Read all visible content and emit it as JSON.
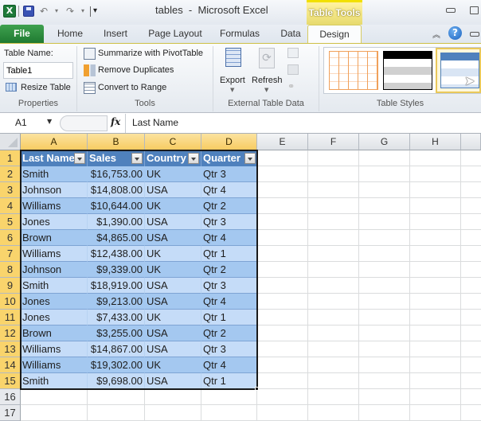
{
  "window": {
    "title": "tables  -  Microsoft Excel",
    "contextual_tab": "Table Tools"
  },
  "tabs": [
    {
      "label": "File"
    },
    {
      "label": "Home"
    },
    {
      "label": "Insert"
    },
    {
      "label": "Page Layout"
    },
    {
      "label": "Formulas"
    },
    {
      "label": "Data"
    },
    {
      "label": "Design",
      "active": true
    }
  ],
  "ribbon": {
    "properties": {
      "table_name_label": "Table Name:",
      "table_name_value": "Table1",
      "resize_label": "Resize Table",
      "group_label": "Properties"
    },
    "tools": {
      "summarize_label": "Summarize with PivotTable",
      "remove_dup_label": "Remove Duplicates",
      "convert_label": "Convert to Range",
      "group_label": "Tools"
    },
    "external": {
      "export_label": "Export",
      "refresh_label": "Refresh",
      "group_label": "External Table Data"
    },
    "styles": {
      "group_label": "Table Styles"
    }
  },
  "formula_bar": {
    "name_box": "A1",
    "fx": "fx",
    "value": "Last Name"
  },
  "sheet": {
    "columns": [
      "A",
      "B",
      "C",
      "D",
      "E",
      "F",
      "G",
      "H"
    ],
    "row_numbers": [
      "1",
      "2",
      "3",
      "4",
      "5",
      "6",
      "7",
      "8",
      "9",
      "10",
      "11",
      "12",
      "13",
      "14",
      "15",
      "16",
      "17"
    ],
    "table_headers": [
      "Last Name",
      "Sales",
      "Country",
      "Quarter"
    ],
    "rows": [
      [
        "Smith",
        "$16,753.00",
        "UK",
        "Qtr 3"
      ],
      [
        "Johnson",
        "$14,808.00",
        "USA",
        "Qtr 4"
      ],
      [
        "Williams",
        "$10,644.00",
        "UK",
        "Qtr 2"
      ],
      [
        "Jones",
        "$1,390.00",
        "USA",
        "Qtr 3"
      ],
      [
        "Brown",
        "$4,865.00",
        "USA",
        "Qtr 4"
      ],
      [
        "Williams",
        "$12,438.00",
        "UK",
        "Qtr 1"
      ],
      [
        "Johnson",
        "$9,339.00",
        "UK",
        "Qtr 2"
      ],
      [
        "Smith",
        "$18,919.00",
        "USA",
        "Qtr 3"
      ],
      [
        "Jones",
        "$9,213.00",
        "USA",
        "Qtr 4"
      ],
      [
        "Jones",
        "$7,433.00",
        "UK",
        "Qtr 1"
      ],
      [
        "Brown",
        "$3,255.00",
        "USA",
        "Qtr 2"
      ],
      [
        "Williams",
        "$14,867.00",
        "USA",
        "Qtr 3"
      ],
      [
        "Williams",
        "$19,302.00",
        "UK",
        "Qtr 4"
      ],
      [
        "Smith",
        "$9,698.00",
        "USA",
        "Qtr 1"
      ]
    ]
  },
  "colors": {
    "header_fill": "#4f81bd",
    "band_dark": "#a4c8f0",
    "band_light": "#c5dcf8",
    "selected_header": "#f9d46c",
    "contextual_tab": "#e7da6e",
    "file_tab": "#2a8a3c"
  }
}
